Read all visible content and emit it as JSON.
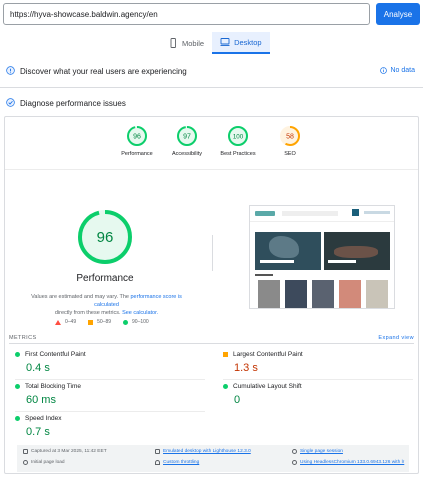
{
  "url_bar": {
    "value": "https://hyva-showcase.baldwin.agency/en",
    "analyze_label": "Analyse"
  },
  "device_tabs": [
    {
      "label": "Mobile",
      "active": false
    },
    {
      "label": "Desktop",
      "active": true
    }
  ],
  "real_users": {
    "title": "Discover what your real users are experiencing",
    "no_data_label": "No data"
  },
  "diagnose": {
    "title": "Diagnose performance issues"
  },
  "categories": [
    {
      "label": "Performance",
      "score": "96",
      "color": "#0cce6b",
      "fraction": 0.96
    },
    {
      "label": "Accessibility",
      "score": "97",
      "color": "#0cce6b",
      "fraction": 0.97
    },
    {
      "label": "Best Practices",
      "score": "100",
      "color": "#0cce6b",
      "fraction": 1.0
    },
    {
      "label": "SEO",
      "score": "58",
      "color": "#ffa400",
      "fraction": 0.58
    }
  ],
  "performance": {
    "score": "96",
    "fraction": 0.96,
    "title": "Performance",
    "note_prefix": "Values are estimated and may vary. The",
    "note_link1": "performance score is calculated",
    "note_middle": "directly from these metrics.",
    "note_link2": "See calculator."
  },
  "legend": [
    {
      "range": "0–49",
      "shape": "triangle"
    },
    {
      "range": "50–89",
      "shape": "square"
    },
    {
      "range": "90–100",
      "shape": "circle"
    }
  ],
  "metrics": {
    "header": "METRICS",
    "expand_label": "Expand view",
    "items": [
      {
        "label": "First Contentful Paint",
        "value": "0.4 s",
        "status": "good"
      },
      {
        "label": "Largest Contentful Paint",
        "value": "1.3 s",
        "status": "average"
      },
      {
        "label": "Total Blocking Time",
        "value": "60 ms",
        "status": "good"
      },
      {
        "label": "Cumulative Layout Shift",
        "value": "0",
        "status": "good"
      },
      {
        "label": "Speed Index",
        "value": "0.7 s",
        "status": "good"
      }
    ]
  },
  "footer": {
    "captured": "Captured at 3 Mar 2025, 11:42 EET",
    "emulated": "Emulated desktop with Lighthouse 12.3.0",
    "session": "Single page session",
    "initial_load": "Initial page load",
    "throttling": "Custom throttling",
    "browser": "Using HeadlessChromium 133.0.6943.126 with lr"
  },
  "colors": {
    "good": "#0cce6b",
    "average": "#ffa400",
    "good_text": "#018642",
    "average_text": "#c33300",
    "accent": "#1a73e8"
  }
}
